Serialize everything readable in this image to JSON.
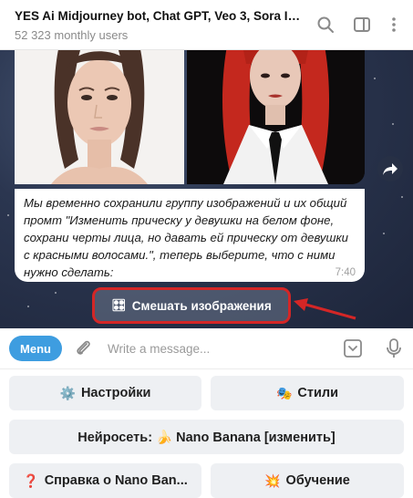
{
  "header": {
    "title": "YES Ai Midjourney bot, Chat GPT, Veo 3, Sora Ima...",
    "subtitle": "52 323 monthly users"
  },
  "icons": {
    "search": "search-icon",
    "sidebar": "sidebar-toggle-icon",
    "more": "more-vertical-icon",
    "forward": "forward-icon",
    "attach": "paperclip-icon",
    "keyboard": "keyboard-toggle-icon",
    "mic": "microphone-icon"
  },
  "message": {
    "text": "Мы временно сохранили группу изображений и их общий промт \"Изменить прическу у девушки на белом фоне, сохрани черты лица, но давать ей прическу от девушки с красными волосами.\", теперь выберите, что с ними нужно сделать:",
    "time": "7:40"
  },
  "inline_button": {
    "icon": "🎛",
    "label": "Смешать изображения"
  },
  "input": {
    "menu_label": "Menu",
    "placeholder": "Write a message..."
  },
  "keyboard": {
    "settings_icon": "⚙️",
    "settings": "Настройки",
    "styles_icon": "🎭",
    "styles": "Стили",
    "network": "Нейросеть: 🍌 Nano Banana [изменить]",
    "help_icon": "❓",
    "help": "Справка о Nano Ban...",
    "learn_icon": "💥",
    "learn": "Обучение"
  },
  "colors": {
    "accent": "#3e9de0",
    "highlight": "#d42626",
    "chat_bg": "#2b3650",
    "key_bg": "#eef0f3"
  }
}
